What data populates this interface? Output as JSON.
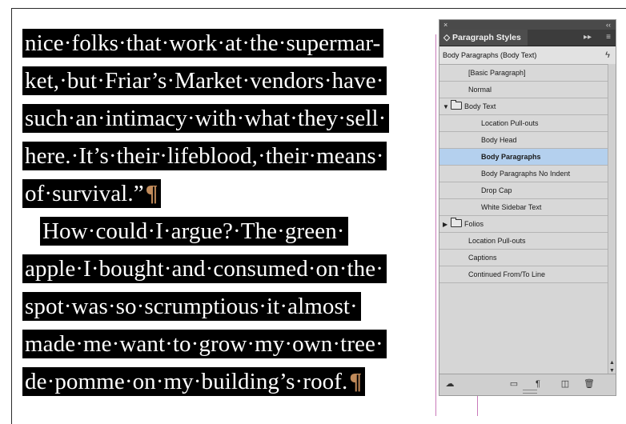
{
  "document": {
    "lines": [
      "nice·folks·that·work·at·the·supermar-",
      "ket,·but·Friar’s·Market·vendors·have·",
      "such·an·intimacy·with·what·they·sell·",
      "here.·It’s·their·lifeblood,·their·means·",
      "of·survival.”",
      "How·could·I·argue?·The·green·",
      "apple·I·bought·and·consumed·on·the·",
      "spot·was·so·scrumptious·it·almost·",
      "made·me·want·to·grow·my·own·tree·",
      "de·pomme·on·my·building’s·roof."
    ],
    "pilcrow": "¶",
    "colors": {
      "highlight": "#000000",
      "pilcrow": "#c08a5a",
      "guide": "#c979b9"
    }
  },
  "panel": {
    "close_glyph": "×",
    "collapse_glyph": "‹‹",
    "tab_label": "Paragraph Styles",
    "tab_arrows": "◇",
    "forward_glyph": "▸▸",
    "menu_glyph": "≡",
    "current_style": "Body Paragraphs (Body Text)",
    "quick_apply_glyph": "ϟ",
    "selected_color": "#b4d0ee",
    "styles": [
      {
        "label": "[Basic Paragraph]",
        "level": 1,
        "folder": false
      },
      {
        "label": "Normal",
        "level": 1,
        "folder": false
      },
      {
        "label": "Body Text",
        "level": 0,
        "folder": true,
        "expanded": true
      },
      {
        "label": "Location Pull-outs",
        "level": 2,
        "folder": false
      },
      {
        "label": "Body Head",
        "level": 2,
        "folder": false
      },
      {
        "label": "Body Paragraphs",
        "level": 2,
        "folder": false,
        "selected": true
      },
      {
        "label": "Body Paragraphs No Indent",
        "level": 2,
        "folder": false
      },
      {
        "label": "Drop Cap",
        "level": 2,
        "folder": false
      },
      {
        "label": "White Sidebar Text",
        "level": 2,
        "folder": false
      },
      {
        "label": "Folios",
        "level": 0,
        "folder": true,
        "expanded": false
      },
      {
        "label": "Location Pull-outs",
        "level": 1,
        "folder": false
      },
      {
        "label": "Captions",
        "level": 1,
        "folder": false
      },
      {
        "label": "Continued From/To Line",
        "level": 1,
        "folder": false
      }
    ],
    "bottom_icons": [
      "cloud-library-icon",
      "new-folder-icon",
      "clear-overrides-icon",
      "new-style-icon",
      "trash-icon"
    ]
  }
}
